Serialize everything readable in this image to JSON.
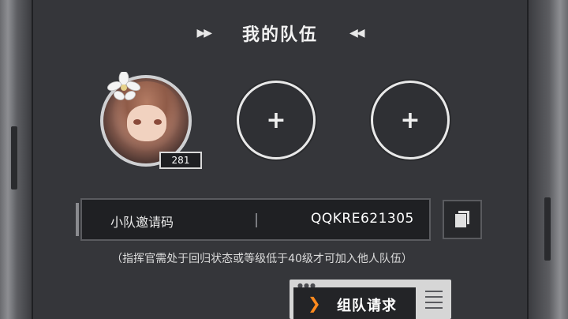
{
  "header": {
    "title": "我的队伍",
    "left_arrows": "▶▶",
    "right_arrows": "◀◀"
  },
  "team": {
    "leader": {
      "level": "281"
    },
    "empty_slots": [
      {
        "icon": "plus-icon",
        "symbol": "+"
      },
      {
        "icon": "plus-icon",
        "symbol": "+"
      }
    ]
  },
  "invite": {
    "label": "小队邀请码",
    "code": "QQKRE621305",
    "copy_icon": "copy-icon"
  },
  "hint": "（指挥官需处于回归状态或等级低于40级才可加入他人队伍）",
  "team_request": {
    "label": "组队请求",
    "icon": "chevron-right-icon"
  },
  "colors": {
    "accent": "#ff8a1e",
    "panel": "#35363a",
    "dark": "#1f2023"
  }
}
